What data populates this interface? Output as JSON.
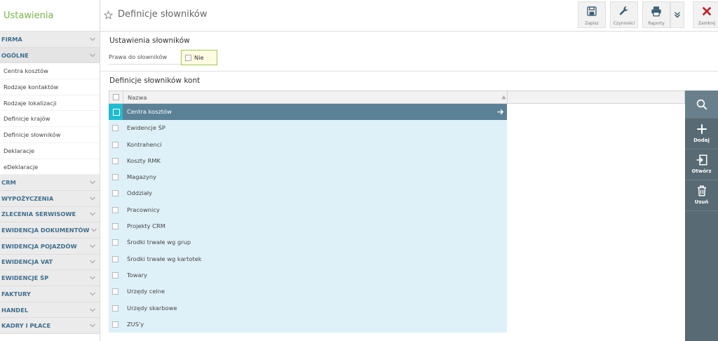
{
  "sidebar": {
    "title": "Ustawienia",
    "sections": [
      {
        "label": "FIRMA"
      },
      {
        "label": "OGÓLNE",
        "items": [
          "Centra kosztów",
          "Rodzaje kontaktów",
          "Rodzaje lokalizacji",
          "Definicje krajów",
          "Definicje słowników",
          "Deklaracje",
          "eDeklaracje"
        ]
      },
      {
        "label": "CRM"
      },
      {
        "label": "WYPOŻYCZENIA"
      },
      {
        "label": "ZLECENIA SERWISOWE"
      },
      {
        "label": "EWIDENCJA DOKUMENTÓW"
      },
      {
        "label": "EWIDENCJA POJAZDÓW"
      },
      {
        "label": "EWIDENCJA VAT"
      },
      {
        "label": "EWIDENCJE ŚP"
      },
      {
        "label": "FAKTURY"
      },
      {
        "label": "HANDEL"
      },
      {
        "label": "KADRY I PŁACE"
      }
    ]
  },
  "header": {
    "title": "Definicje słowników",
    "toolbar": {
      "save_label": "Zapisz",
      "actions_label": "Czynności",
      "reports_label": "Raporty",
      "close_label": "Zamknij"
    }
  },
  "settings": {
    "section_title": "Ustawienia słowników",
    "rights_label": "Prawa do słowników",
    "rights_value": "Nie"
  },
  "grid": {
    "title": "Definicje słowników kont",
    "column_name": "Nazwa",
    "selected_index": 0,
    "rows": [
      "Centra kosztów",
      "Ewidencje ŚP",
      "Kontrahenci",
      "Koszty RMK",
      "Magazyny",
      "Oddziały",
      "Pracownicy",
      "Projekty CRM",
      "Środki trwałe wg grup",
      "Środki trwałe wg kartotek",
      "Towary",
      "Urzędy celne",
      "Urzędy skarbowe",
      "ZUS'y"
    ]
  },
  "actions": {
    "add_label": "Dodaj",
    "open_label": "Otwórz",
    "delete_label": "Usuń"
  },
  "colors": {
    "accent_green": "#7ab648",
    "nav_blue": "#3e6e8e",
    "selected_row": "#5b8196",
    "selected_checkbox": "#1fbcd0",
    "row_bg": "#dff1f8",
    "action_bar": "#586a73",
    "close_red": "#c0212b"
  }
}
